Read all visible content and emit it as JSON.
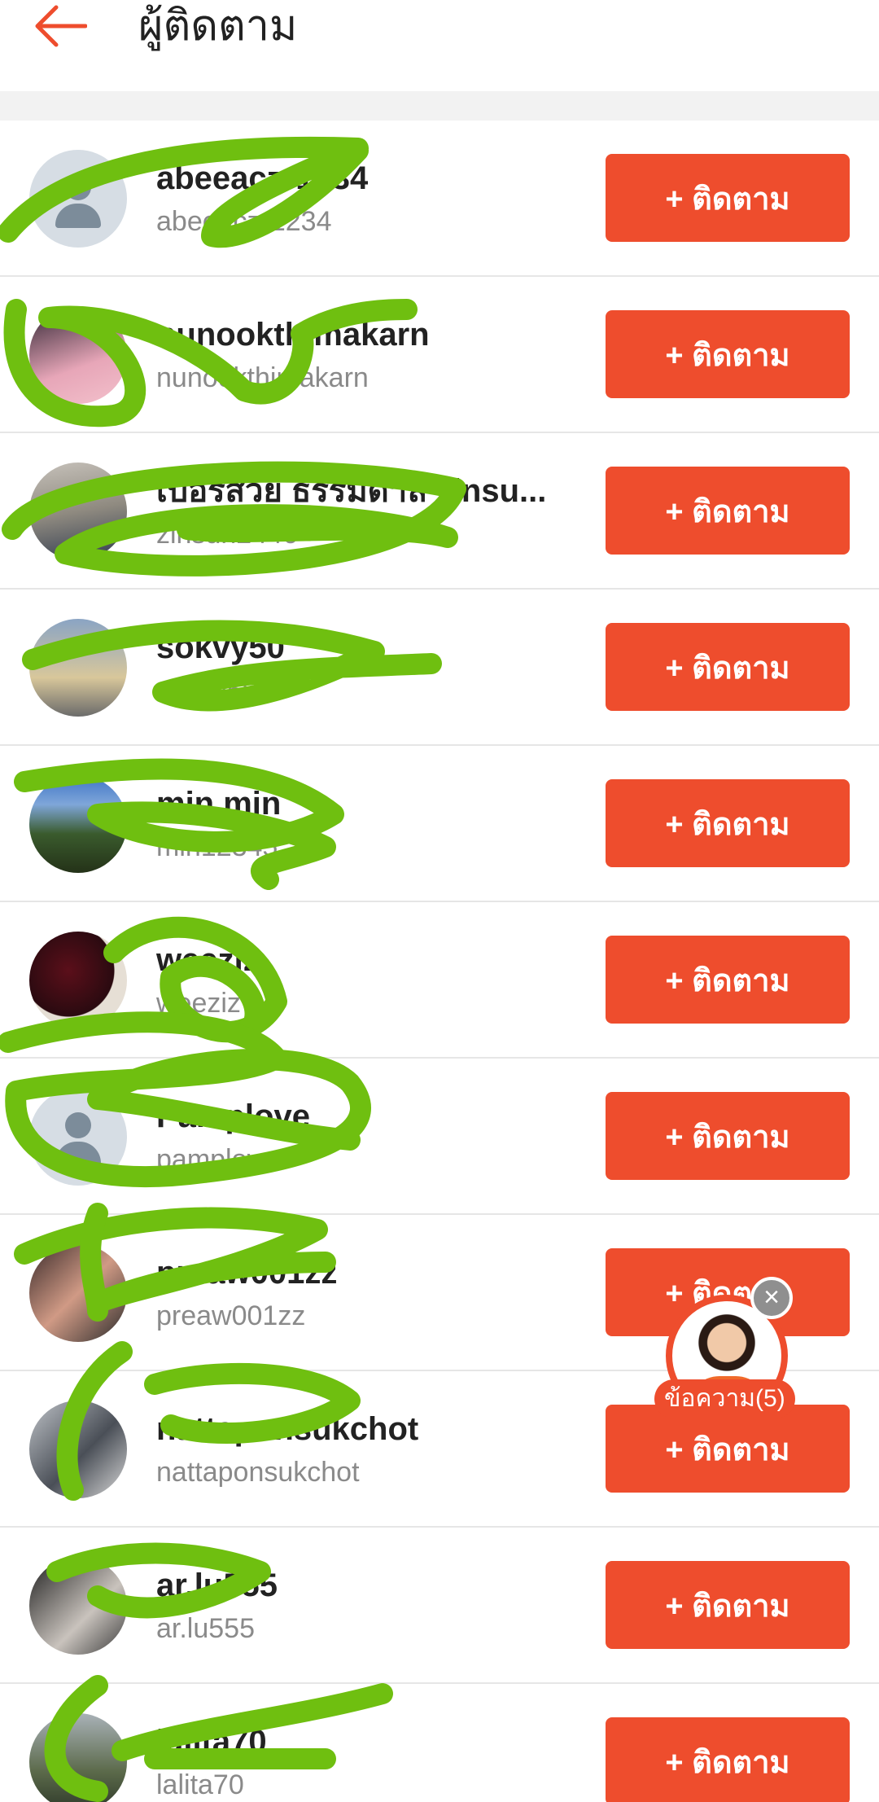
{
  "header": {
    "back_icon": "arrow-left-icon",
    "title": "ผู้ติดตาม"
  },
  "colors": {
    "accent": "#ee4d2d",
    "scribble": "#6fbf10"
  },
  "followers": [
    {
      "name": "abeeaczr1234",
      "handle": "abeeaczr1234",
      "button": "+ ติดตาม",
      "avatar": "placeholder"
    },
    {
      "name": "nunookthimakarn",
      "handle": "nunookthimakarn",
      "button": "+ ติดตาม",
      "avatar": "photo"
    },
    {
      "name": "เบอร์สวย ธรรมดาล zinsu...",
      "handle": "zinsun2446",
      "button": "+ ติดตาม",
      "avatar": "photo"
    },
    {
      "name": "sokvy50",
      "handle": "sokvy50",
      "button": "+ ติดตาม",
      "avatar": "photo"
    },
    {
      "name": "min min",
      "handle": "min12345",
      "button": "+ ติดตาม",
      "avatar": "photo"
    },
    {
      "name": "weeziz",
      "handle": "weeziz",
      "button": "+ ติดตาม",
      "avatar": "photo"
    },
    {
      "name": "Pamplove",
      "handle": "pamplove",
      "button": "+ ติดตาม",
      "avatar": "placeholder"
    },
    {
      "name": "preaw001zz",
      "handle": "preaw001zz",
      "button": "+ ติดตาม",
      "avatar": "photo"
    },
    {
      "name": "nattaponsukchot",
      "handle": "nattaponsukchot",
      "button": "+ ติดตาม",
      "avatar": "photo"
    },
    {
      "name": "ar.lu555",
      "handle": "ar.lu555",
      "button": "+ ติดตาม",
      "avatar": "photo"
    },
    {
      "name": "lalita70",
      "handle": "lalita70",
      "button": "+ ติดตาม",
      "avatar": "photo"
    }
  ],
  "chat": {
    "label": "ข้อความ(5)",
    "close_icon": "close-icon"
  }
}
